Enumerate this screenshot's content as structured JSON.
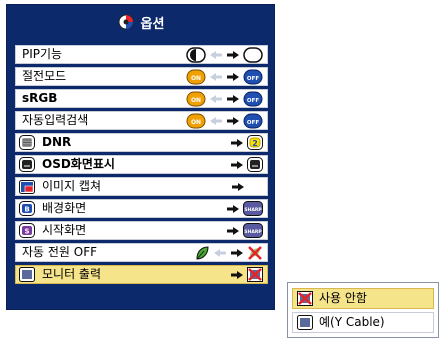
{
  "menu": {
    "title": "옵션",
    "items": [
      {
        "label": "PIP기능",
        "control": "toggle-white",
        "icon": null
      },
      {
        "label": "절전모드",
        "control": "toggle-off",
        "icon": null
      },
      {
        "label": "sRGB",
        "control": "toggle-off",
        "icon": null
      },
      {
        "label": "자동입력검색",
        "control": "toggle-off",
        "icon": null
      },
      {
        "label": "DNR",
        "control": "arrow-2",
        "icon": "dnr-icon"
      },
      {
        "label": "OSD화면표시",
        "control": "arrow-osd",
        "icon": "osd-icon"
      },
      {
        "label": "이미지 캡쳐",
        "control": "arrow-only",
        "icon": "capture-icon"
      },
      {
        "label": "배경화면",
        "control": "arrow-sharp",
        "icon": "background-icon"
      },
      {
        "label": "시작화면",
        "control": "arrow-sharp",
        "icon": "startup-icon"
      },
      {
        "label": "자동 전원 OFF",
        "control": "power-off",
        "icon": null
      },
      {
        "label": "모니터 출력",
        "control": "arrow-monitor",
        "icon": "monitor-icon"
      }
    ],
    "toggle_on_text": "ON",
    "toggle_off_text": "OFF",
    "dnr_value": "2",
    "sharp_text": "SHARP"
  },
  "submenu": {
    "options": [
      {
        "label": "사용 안함",
        "icon": "no-use-icon"
      },
      {
        "label": "예(Y Cable)",
        "icon": "monitor-icon"
      }
    ]
  },
  "colors": {
    "menu_bg": "#0c2a6b",
    "selected_bg": "#f6e48a",
    "toggle_orange": "#f0a000",
    "toggle_blue": "#1f4fb0",
    "red_x": "#e8242a"
  }
}
